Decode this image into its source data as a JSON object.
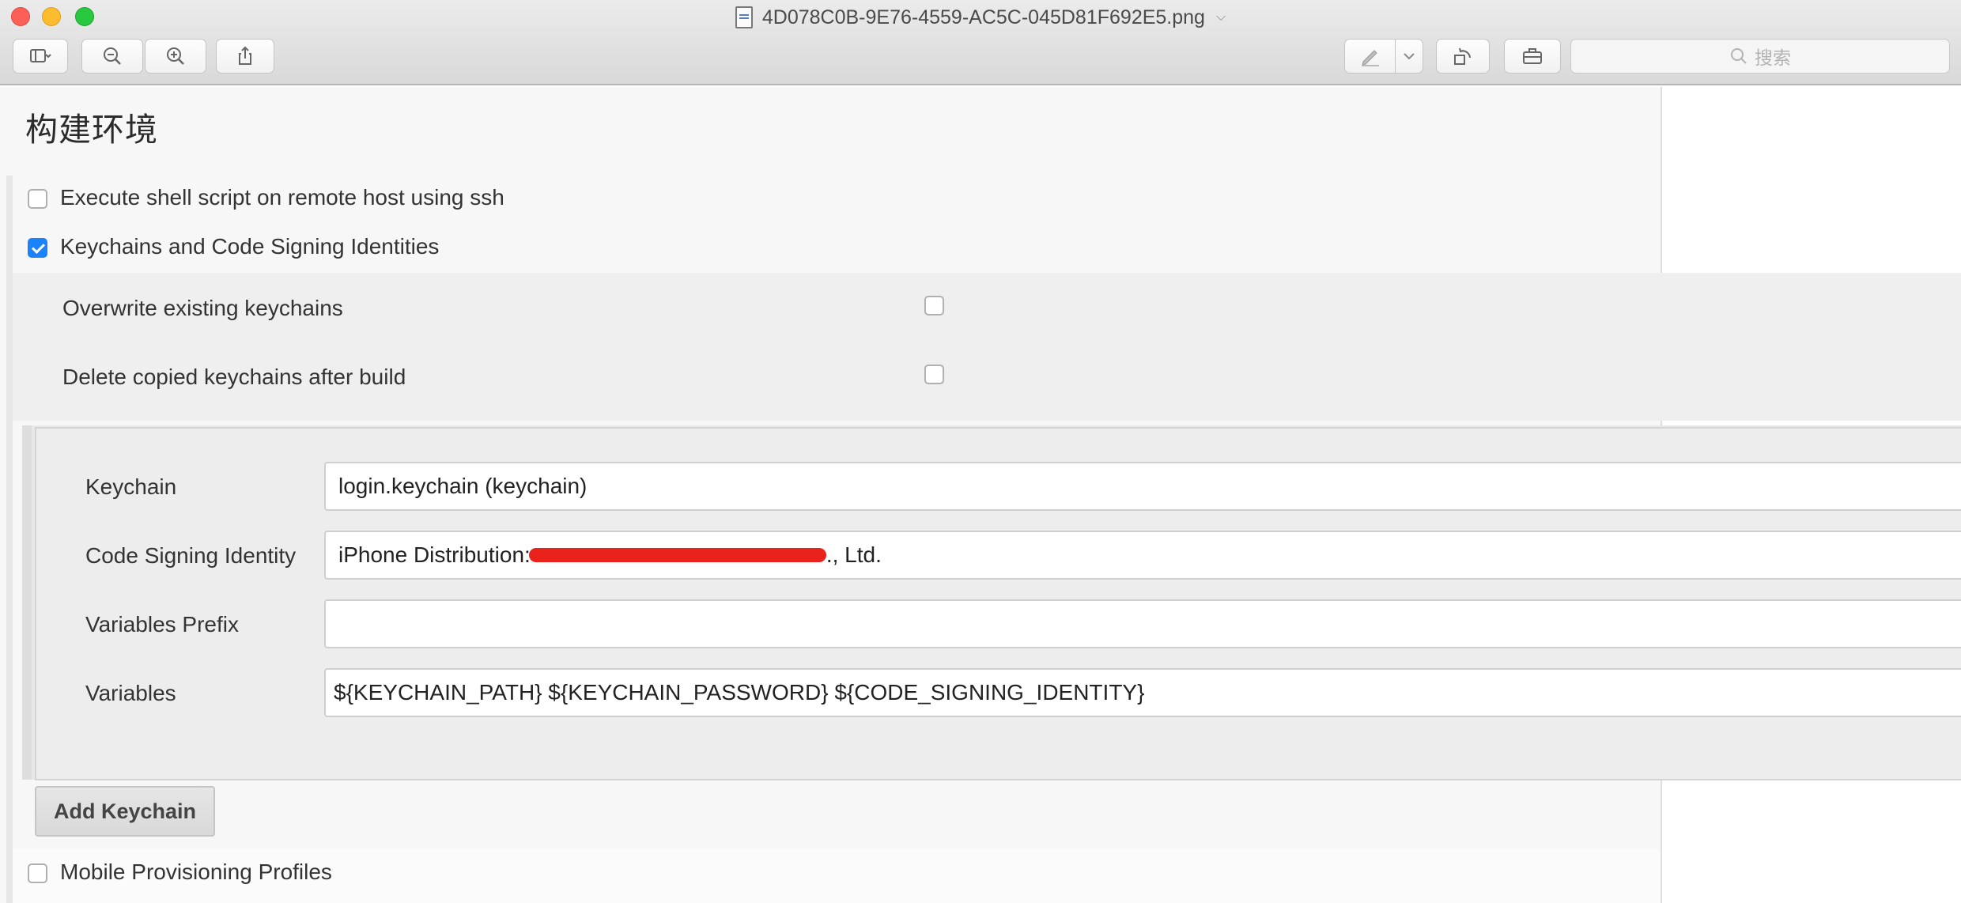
{
  "window": {
    "title": "4D078C0B-9E76-4559-AC5C-045D81F692E5.png",
    "search_placeholder": "搜索"
  },
  "toolbar": {
    "sidebar_toggle": "sidebar-icon",
    "zoom_out": "zoom-out-icon",
    "zoom_in": "zoom-in-icon",
    "share": "share-icon",
    "markup": "pen-icon",
    "rotate": "rotate-icon",
    "toolbox": "toolbox-icon"
  },
  "page": {
    "section_title": "构建环境",
    "options": [
      {
        "label": "Execute shell script on remote host using ssh",
        "checked": false
      },
      {
        "label": "Keychains and Code Signing Identities",
        "checked": true
      },
      {
        "label": "Mobile Provisioning Profiles",
        "checked": false
      }
    ],
    "keychain_options": [
      {
        "label": "Overwrite existing keychains",
        "checked": false
      },
      {
        "label": "Delete copied keychains after build",
        "checked": false
      }
    ],
    "keychain_form": {
      "keychain_label": "Keychain",
      "keychain_value": "login.keychain (keychain)",
      "identity_label": "Code Signing Identity",
      "identity_prefix": "iPhone Distribution:",
      "identity_suffix": "., Ltd.",
      "prefix_label": "Variables Prefix",
      "prefix_value": "",
      "variables_label": "Variables",
      "variables_value": "${KEYCHAIN_PATH} ${KEYCHAIN_PASSWORD} ${CODE_SIGNING_IDENTITY}"
    },
    "add_keychain_label": "Add Keychain"
  },
  "colors": {
    "accent": "#1a82fb",
    "redaction": "#e9231b"
  }
}
